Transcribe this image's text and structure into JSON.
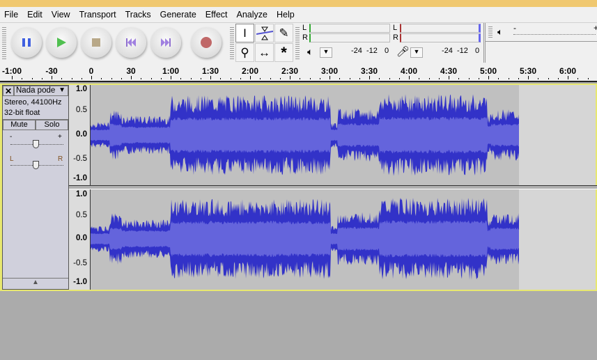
{
  "menu": [
    "File",
    "Edit",
    "View",
    "Transport",
    "Tracks",
    "Generate",
    "Effect",
    "Analyze",
    "Help"
  ],
  "transport": {
    "pause": "pause",
    "play": "play",
    "stop": "stop",
    "skip_start": "skip-to-start",
    "skip_end": "skip-to-end",
    "record": "record"
  },
  "meters": {
    "playback": {
      "L": "L",
      "R": "R",
      "scale": [
        "-24",
        "-12",
        "0"
      ]
    },
    "record": {
      "L": "L",
      "R": "R",
      "scale": [
        "-24",
        "-12",
        "0"
      ]
    },
    "volume_minus": "-",
    "volume_plus": "+"
  },
  "ruler": {
    "labels": [
      "-1:00",
      "-30",
      "0",
      "30",
      "1:00",
      "1:30",
      "2:00",
      "2:30",
      "3:00",
      "3:30",
      "4:00",
      "4:30",
      "5:00",
      "5:30",
      "6:00"
    ]
  },
  "track": {
    "name": "Nada pode",
    "info1": "Stereo, 44100Hz",
    "info2": "32-bit float",
    "mute": "Mute",
    "solo": "Solo",
    "gain_minus": "-",
    "gain_plus": "+",
    "pan_left": "L",
    "pan_right": "R",
    "close": "✕",
    "collapse": "▲"
  },
  "scale": [
    "1.0",
    "0.5",
    "0.0",
    "-0.5",
    "-1.0"
  ],
  "colors": {
    "wave": "#3232c8",
    "wave_rms": "#6464dc",
    "wave_bg": "#c0c0c0"
  }
}
